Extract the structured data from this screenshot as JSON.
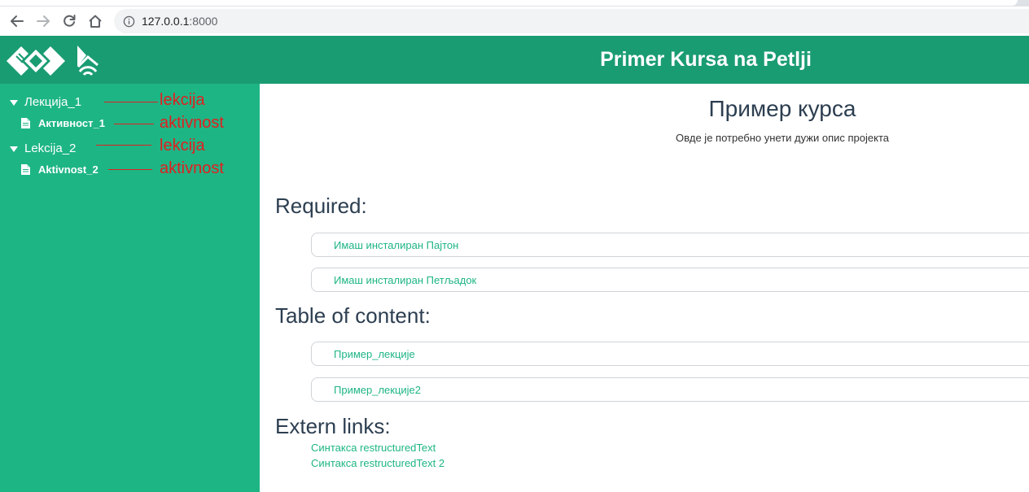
{
  "browser": {
    "url_host": "127.0.0.1",
    "url_port": ":8000"
  },
  "header": {
    "title": "Primer Kursa na Petlji",
    "logo_icon": "petlja-logo-icon",
    "wifi_logo_icon": "petlja-signal-logo-icon"
  },
  "sidebar": {
    "items": [
      {
        "type": "lesson",
        "label": "Лекција_1",
        "annotation": "lekcija"
      },
      {
        "type": "activity",
        "label": "Активност_1",
        "annotation": "aktivnost"
      },
      {
        "type": "lesson",
        "label": "Lekcija_2",
        "annotation": "lekcija"
      },
      {
        "type": "activity",
        "label": "Aktivnost_2",
        "annotation": "aktivnost"
      }
    ]
  },
  "main": {
    "course_title": "Пример курса",
    "course_description": "Овде је потребно унети дужи опис пројекта",
    "required": {
      "heading": "Required:",
      "items": [
        "Имаш инсталиран Пајтон",
        "Имаш инсталиран Петљадок"
      ]
    },
    "toc": {
      "heading": "Table of content:",
      "items": [
        "Пример_лекције",
        "Пример_лекције2"
      ]
    },
    "extern": {
      "heading": "Extern links:",
      "links": [
        "Синтакса restructuredText",
        "Синтакса restructuredText 2"
      ]
    }
  },
  "colors": {
    "header": "#1a9c72",
    "sidebar": "#1eb585",
    "annotation": "#e02020",
    "link": "#1eb585"
  }
}
